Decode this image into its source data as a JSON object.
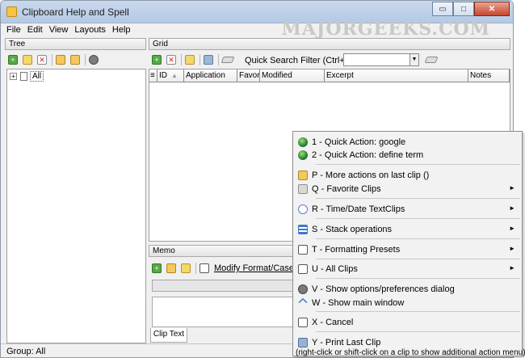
{
  "window": {
    "title": "Clipboard Help and Spell",
    "controls": {
      "minimize": "▭",
      "maximize": "□",
      "close": "✕"
    },
    "watermark": "MAJORGEEKS.COM"
  },
  "menubar": [
    "File",
    "Edit",
    "View",
    "Layouts",
    "Help"
  ],
  "tree": {
    "header": "Tree",
    "root_label": "All",
    "expander": "+"
  },
  "grid": {
    "header": "Grid",
    "quick_search_label": "Quick Search Filter (Ctrl+F):",
    "quick_search_value": "",
    "columns": [
      "ID",
      "Application",
      "Favori",
      "Modified",
      "Excerpt",
      "Notes"
    ]
  },
  "memo": {
    "header": "Memo",
    "modify_button": "Modify Format/Case",
    "tab": "Clip Text"
  },
  "status": {
    "group_label": "Group:",
    "group_value": "All"
  },
  "context_menu": {
    "items": [
      {
        "label": "1 - Quick Action: google",
        "icon": "globe-icon",
        "submenu": false
      },
      {
        "label": "2 - Quick Action: define term",
        "icon": "globe-icon",
        "submenu": false
      },
      {
        "label": "P - More actions on last clip ()",
        "icon": "clipboard-icon",
        "submenu": false
      },
      {
        "label": "Q - Favorite Clips",
        "icon": "favorite-icon",
        "submenu": true
      },
      {
        "label": "R - Time/Date TextClips",
        "icon": "clock-icon",
        "submenu": true
      },
      {
        "label": "S - Stack operations",
        "icon": "stack-icon",
        "submenu": true
      },
      {
        "label": "T - Formatting Presets",
        "icon": "format-icon",
        "submenu": true
      },
      {
        "label": "U - All Clips",
        "icon": "document-icon",
        "submenu": true
      },
      {
        "label": "V - Show options/preferences dialog",
        "icon": "gear-icon",
        "submenu": false
      },
      {
        "label": "W - Show main window",
        "icon": "chevron-up-icon",
        "submenu": false
      },
      {
        "label": "X - Cancel",
        "icon": "cancel-icon",
        "submenu": false
      },
      {
        "label": "Y - Print Last Clip",
        "icon": "printer-icon",
        "submenu": false
      }
    ],
    "submenu_arrow": "►",
    "footer_note": "(right-click or shift-click on a clip to show additional action menu)"
  }
}
